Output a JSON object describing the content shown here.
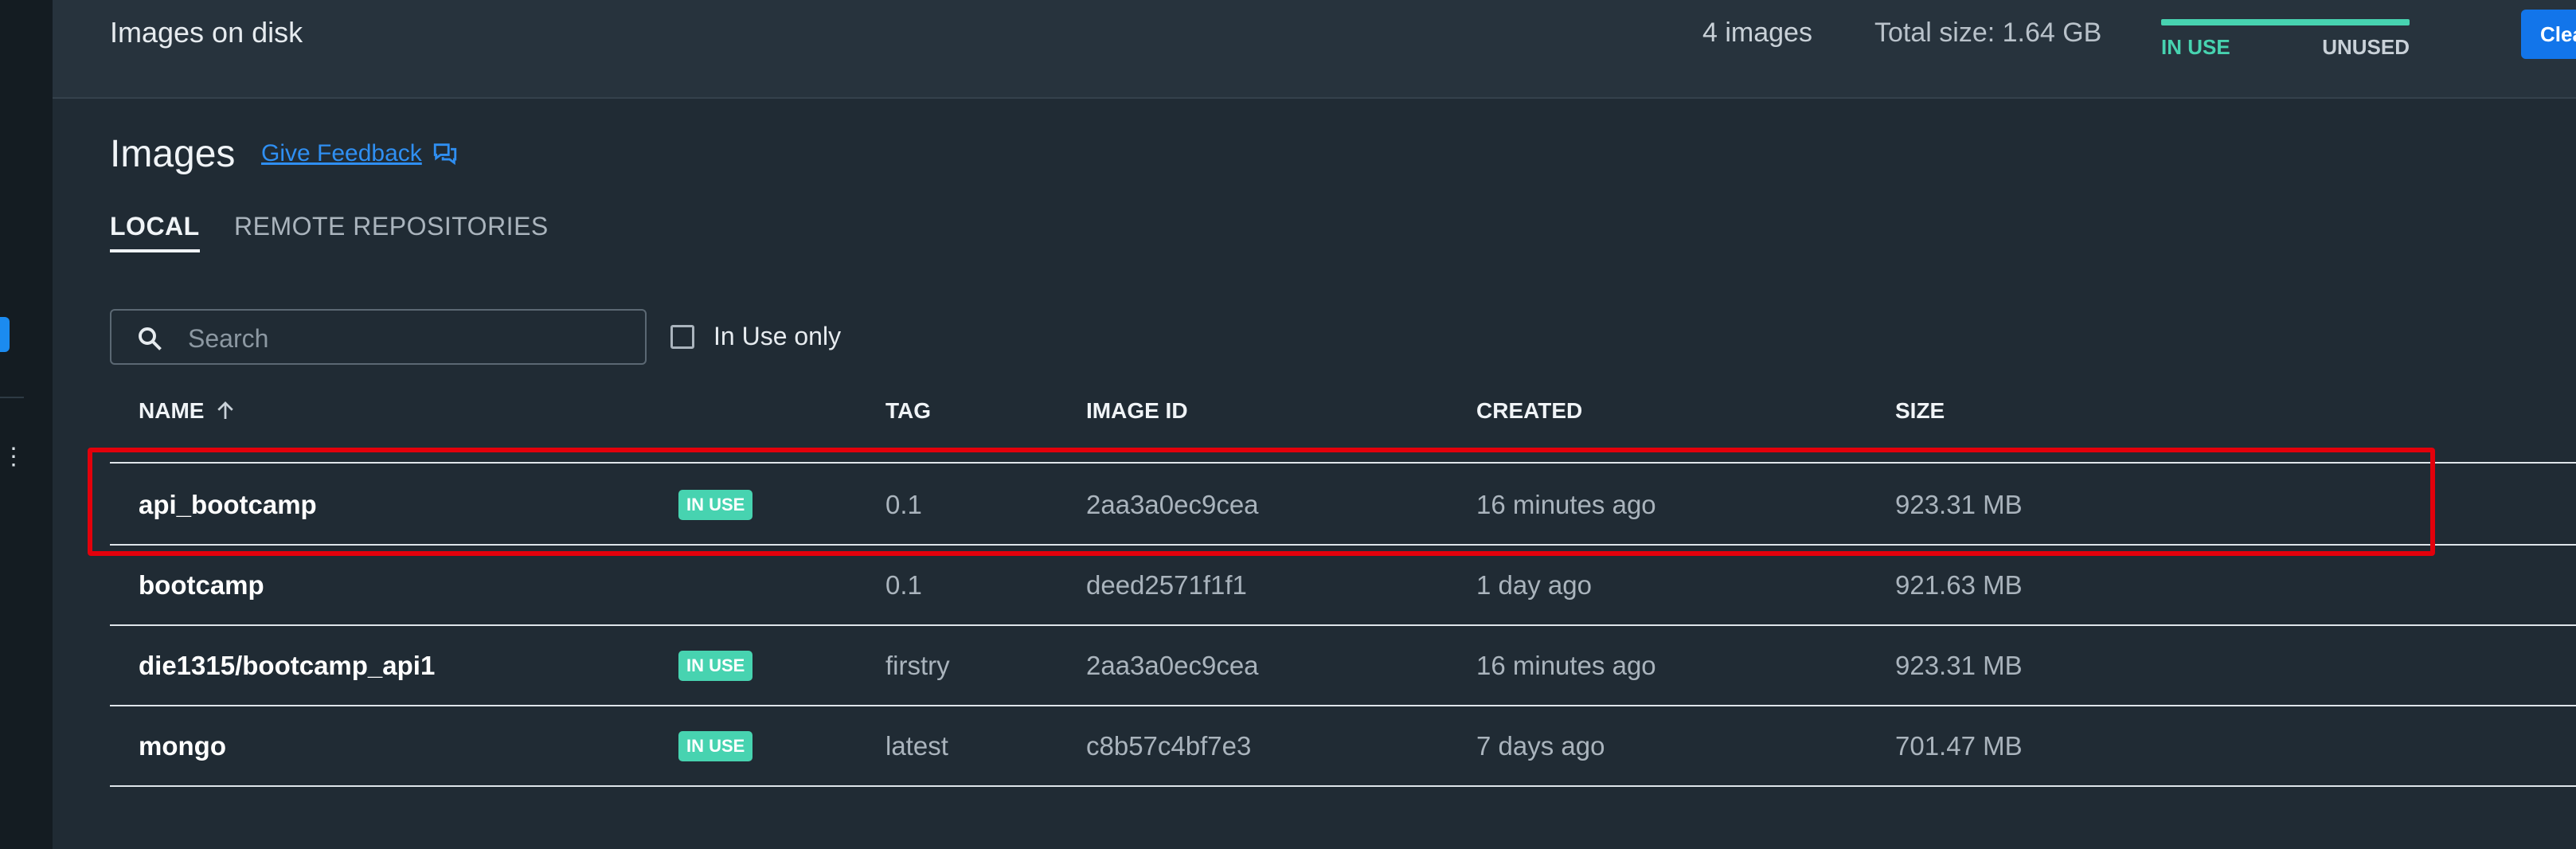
{
  "topbar": {
    "title": "Images on disk",
    "image_count": "4 images",
    "total_size": "Total size: 1.64 GB",
    "usage_inuse_label": "IN USE",
    "usage_unused_label": "UNUSED",
    "cleanup_label": "Clean up..."
  },
  "page": {
    "title": "Images",
    "feedback_label": "Give Feedback"
  },
  "tabs": [
    {
      "label": "LOCAL"
    },
    {
      "label": "REMOTE REPOSITORIES"
    }
  ],
  "search": {
    "placeholder": "Search",
    "value": ""
  },
  "filter": {
    "in_use_label": "In Use only",
    "checked": false
  },
  "table": {
    "headers": {
      "name": "NAME",
      "tag": "TAG",
      "image_id": "IMAGE ID",
      "created": "CREATED",
      "size": "SIZE"
    },
    "rows": [
      {
        "name": "api_bootcamp",
        "badge": "IN USE",
        "tag": "0.1",
        "image_id": "2aa3a0ec9cea",
        "created": "16 minutes ago",
        "size": "923.31 MB"
      },
      {
        "name": "bootcamp",
        "badge": "",
        "tag": "0.1",
        "image_id": "deed2571f1f1",
        "created": "1 day ago",
        "size": "921.63 MB"
      },
      {
        "name": "die1315/bootcamp_api1",
        "badge": "IN USE",
        "tag": "firstry",
        "image_id": "2aa3a0ec9cea",
        "created": "16 minutes ago",
        "size": "923.31 MB"
      },
      {
        "name": "mongo",
        "badge": "IN USE",
        "tag": "latest",
        "image_id": "c8b57c4bf7e3",
        "created": "7 days ago",
        "size": "701.47 MB"
      }
    ]
  },
  "colors": {
    "accent": "#1275ea",
    "in_use": "#47d3b0",
    "highlight": "#e3000b",
    "background": "#202b34"
  },
  "icons": [
    "search-icon",
    "feedback-icon",
    "sort-ascending-icon",
    "more-vertical-icon"
  ]
}
